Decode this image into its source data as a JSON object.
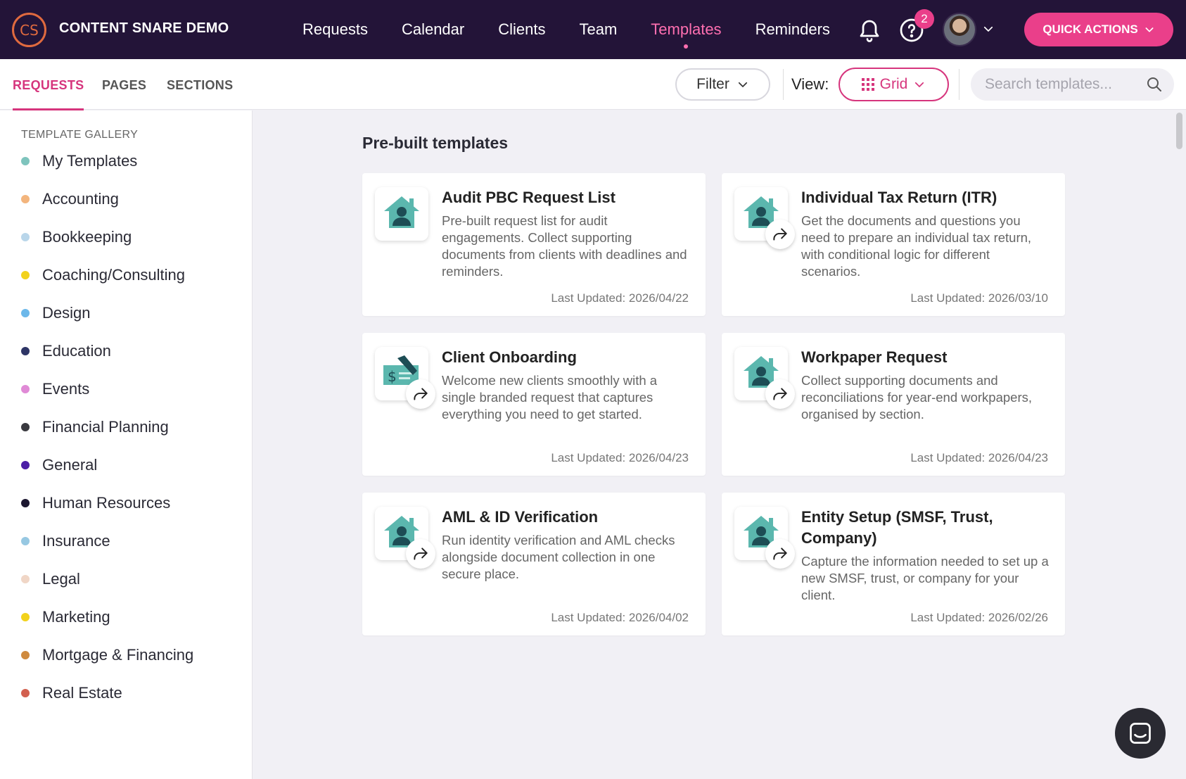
{
  "brand": {
    "logo_text": "CS",
    "name": "CONTENT SNARE DEMO"
  },
  "nav": {
    "items": [
      {
        "label": "Requests"
      },
      {
        "label": "Calendar"
      },
      {
        "label": "Clients"
      },
      {
        "label": "Team"
      },
      {
        "label": "Templates",
        "active": true
      },
      {
        "label": "Reminders"
      }
    ],
    "help_badge_count": "2",
    "quick_actions_label": "QUICK ACTIONS"
  },
  "subnav": {
    "tabs": [
      {
        "label": "REQUESTS",
        "active": true
      },
      {
        "label": "PAGES"
      },
      {
        "label": "SECTIONS"
      }
    ],
    "filter_label": "Filter",
    "view_label": "View:",
    "view_value": "Grid",
    "search_placeholder": "Search templates..."
  },
  "sidebar": {
    "heading": "TEMPLATE GALLERY",
    "categories": [
      {
        "label": "My Templates",
        "color": "#7ec4bd"
      },
      {
        "label": "Accounting",
        "color": "#f3b57d"
      },
      {
        "label": "Bookkeeping",
        "color": "#b9d6ea"
      },
      {
        "label": "Coaching/Consulting",
        "color": "#f2d21c"
      },
      {
        "label": "Design",
        "color": "#6cb8ea"
      },
      {
        "label": "Education",
        "color": "#2e3566"
      },
      {
        "label": "Events",
        "color": "#e08ad6"
      },
      {
        "label": "Financial Planning",
        "color": "#3a3a40"
      },
      {
        "label": "General",
        "color": "#4b1ea6"
      },
      {
        "label": "Human Resources",
        "color": "#1c1730"
      },
      {
        "label": "Insurance",
        "color": "#97c8e2"
      },
      {
        "label": "Legal",
        "color": "#f0d6c6"
      },
      {
        "label": "Marketing",
        "color": "#f2d21c"
      },
      {
        "label": "Mortgage & Financing",
        "color": "#cf8a3e"
      },
      {
        "label": "Real Estate",
        "color": "#d2604f"
      }
    ]
  },
  "main": {
    "section_title": "Pre-built templates",
    "cards": [
      {
        "title": "Audit PBC Request List",
        "desc": "Pre-built request list for audit engagements. Collect supporting documents from clients with deadlines and reminders.",
        "updated": "Last Updated: 2026/04/22",
        "icon": "house-person-icon",
        "shared": false
      },
      {
        "title": "Individual Tax Return (ITR)",
        "desc": "Get the documents and questions you need to prepare an individual tax return, with conditional logic for different scenarios.",
        "updated": "Last Updated: 2026/03/10",
        "icon": "house-person-icon",
        "shared": true
      },
      {
        "title": "Client Onboarding",
        "desc": "Welcome new clients smoothly with a single branded request that captures everything you need to get started.",
        "updated": "Last Updated: 2026/04/23",
        "icon": "check-pen-icon",
        "shared": true
      },
      {
        "title": "Workpaper Request",
        "desc": "Collect supporting documents and reconciliations for year-end workpapers, organised by section.",
        "updated": "Last Updated: 2026/04/23",
        "icon": "house-person-icon",
        "shared": true
      },
      {
        "title": "AML & ID Verification",
        "desc": "Run identity verification and AML checks alongside document collection in one secure place.",
        "updated": "Last Updated: 2026/04/02",
        "icon": "house-person-icon",
        "shared": true
      },
      {
        "title": "Entity Setup (SMSF, Trust, Company)",
        "desc": "Capture the information needed to set up a new SMSF, trust, or company for your client.",
        "updated": "Last Updated: 2026/02/26",
        "icon": "house-person-icon",
        "shared": true
      }
    ]
  },
  "colors": {
    "accent": "#ea3f8a",
    "topbar": "#231438",
    "teal": "#5bb7ae"
  }
}
